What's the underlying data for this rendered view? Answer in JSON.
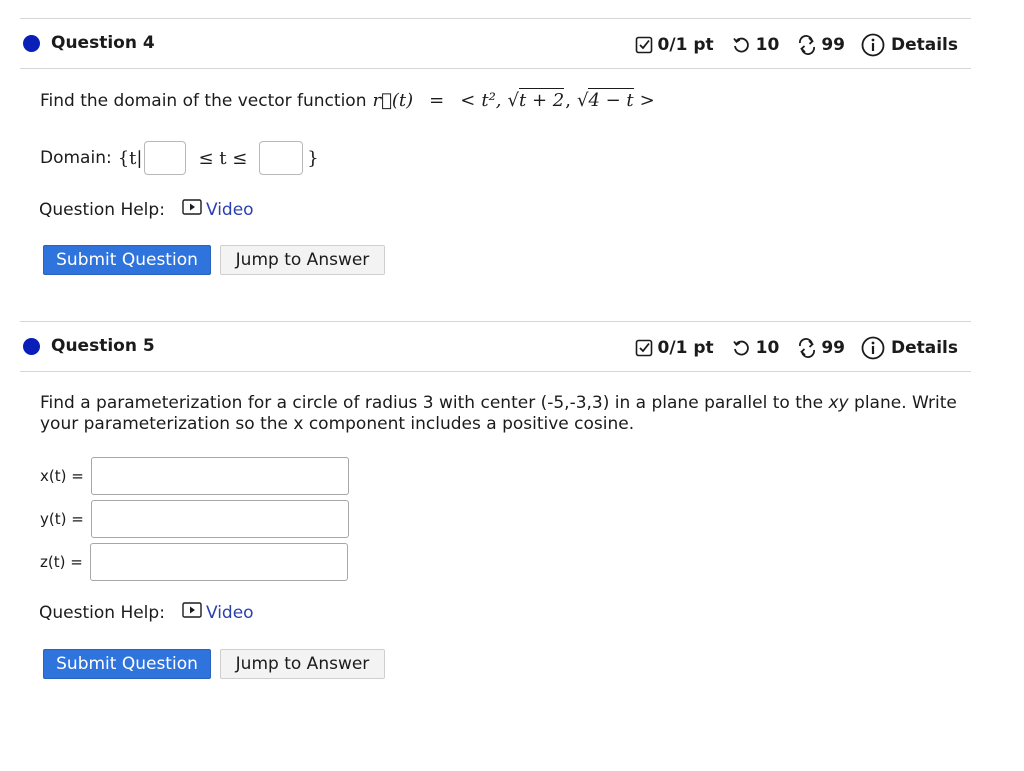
{
  "q4": {
    "title": "Question 4",
    "score": "0/1 pt",
    "retries": "10",
    "attempts": "99",
    "details": "Details",
    "prompt": "Find the domain of the vector function",
    "math": {
      "lhs": "r⃗(t)",
      "equals": "=",
      "open": "<",
      "t_sq": "t²,",
      "sqrt1": "t + 2",
      "comma": ",",
      "sqrt2": "4 − t",
      "close": ">"
    },
    "domain_label": "Domain:",
    "domain_open": "{t|",
    "domain_mid": "≤ t ≤",
    "domain_close": "}",
    "help_label": "Question Help:",
    "video_label": "Video",
    "submit_label": "Submit Question",
    "jump_label": "Jump to Answer"
  },
  "q5": {
    "title": "Question 5",
    "score": "0/1 pt",
    "retries": "10",
    "attempts": "99",
    "details": "Details",
    "prompt_a": "Find a parameterization for a circle of radius 3 with center (-5,-3,3) in a plane parallel to the",
    "prompt_italic": "xy",
    "prompt_b": "plane. Write",
    "prompt_line2": "your parameterization so the x component includes a positive cosine.",
    "fields": [
      {
        "label": "x(t) ="
      },
      {
        "label": "y(t) ="
      },
      {
        "label": "z(t) ="
      }
    ],
    "help_label": "Question Help:",
    "video_label": "Video",
    "submit_label": "Submit Question",
    "jump_label": "Jump to Answer"
  },
  "colors": {
    "dot": "#0a1fb8",
    "primary_button": "#2f74dc",
    "link": "#2a3fb0"
  }
}
